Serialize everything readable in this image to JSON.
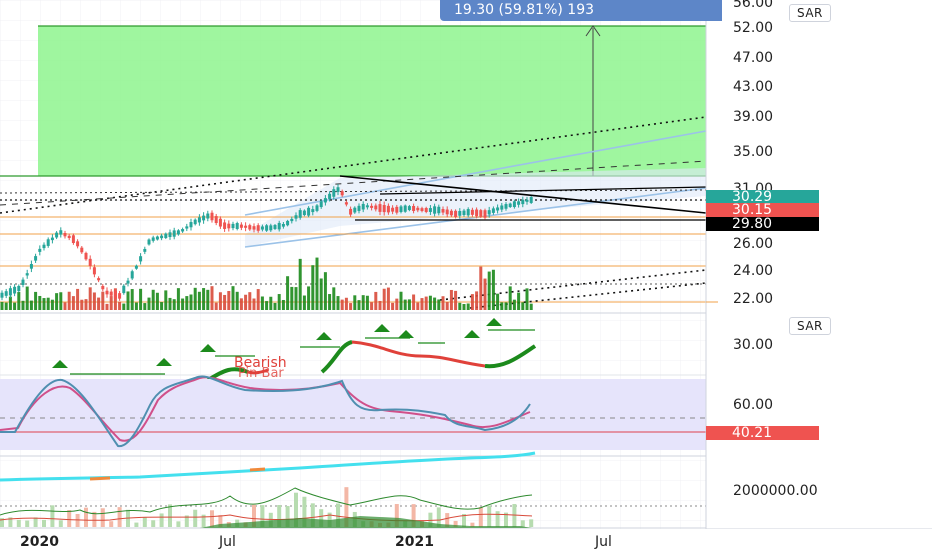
{
  "chart_data": [
    {
      "type": "candlestick",
      "pane": "price",
      "title": "",
      "ylim": [
        20.5,
        56.5
      ],
      "y_ticks": [
        "56.00",
        "52.00",
        "47.00",
        "43.00",
        "39.00",
        "35.00",
        "31.00",
        "26.00",
        "24.00",
        "22.00"
      ],
      "measure_label": "19.30 (59.81%) 193",
      "price_labels": [
        {
          "value": "30.29",
          "color": "#26a69a"
        },
        {
          "value": "30.15",
          "color": "#ef5350"
        },
        {
          "value": "29.80",
          "color": "#000000"
        }
      ],
      "scale_button": "SAR",
      "annotation": "Bearish Pin Bar",
      "x_axis_labels": [
        "2020",
        "Jul",
        "2021",
        "Jul"
      ],
      "colors": {
        "up": "#26a69a",
        "down": "#ef5350",
        "target_zone": "#8ef58e",
        "volume_up": "#1b8a1b",
        "volume_down": "#d84a3a"
      }
    },
    {
      "type": "line",
      "pane": "indicator",
      "scale_button": "SAR",
      "y_ticks": [
        "30.00"
      ]
    },
    {
      "type": "line",
      "pane": "oscillator",
      "y_ticks": [
        "60.00"
      ],
      "price_labels": [
        {
          "value": "40.21",
          "color": "#ef5350"
        }
      ],
      "colors": {
        "fast": "#4f8fb0",
        "slow": "#d0508a",
        "band": "#e6e4fb",
        "threshold": "#e06070"
      }
    },
    {
      "type": "bar",
      "pane": "volume_oscillator",
      "y_ticks": [
        "2000000.00"
      ],
      "colors": {
        "trend": "#44e0ee",
        "bars_up": "#b7dcb0",
        "bars_down": "#f3b7a6"
      }
    }
  ]
}
